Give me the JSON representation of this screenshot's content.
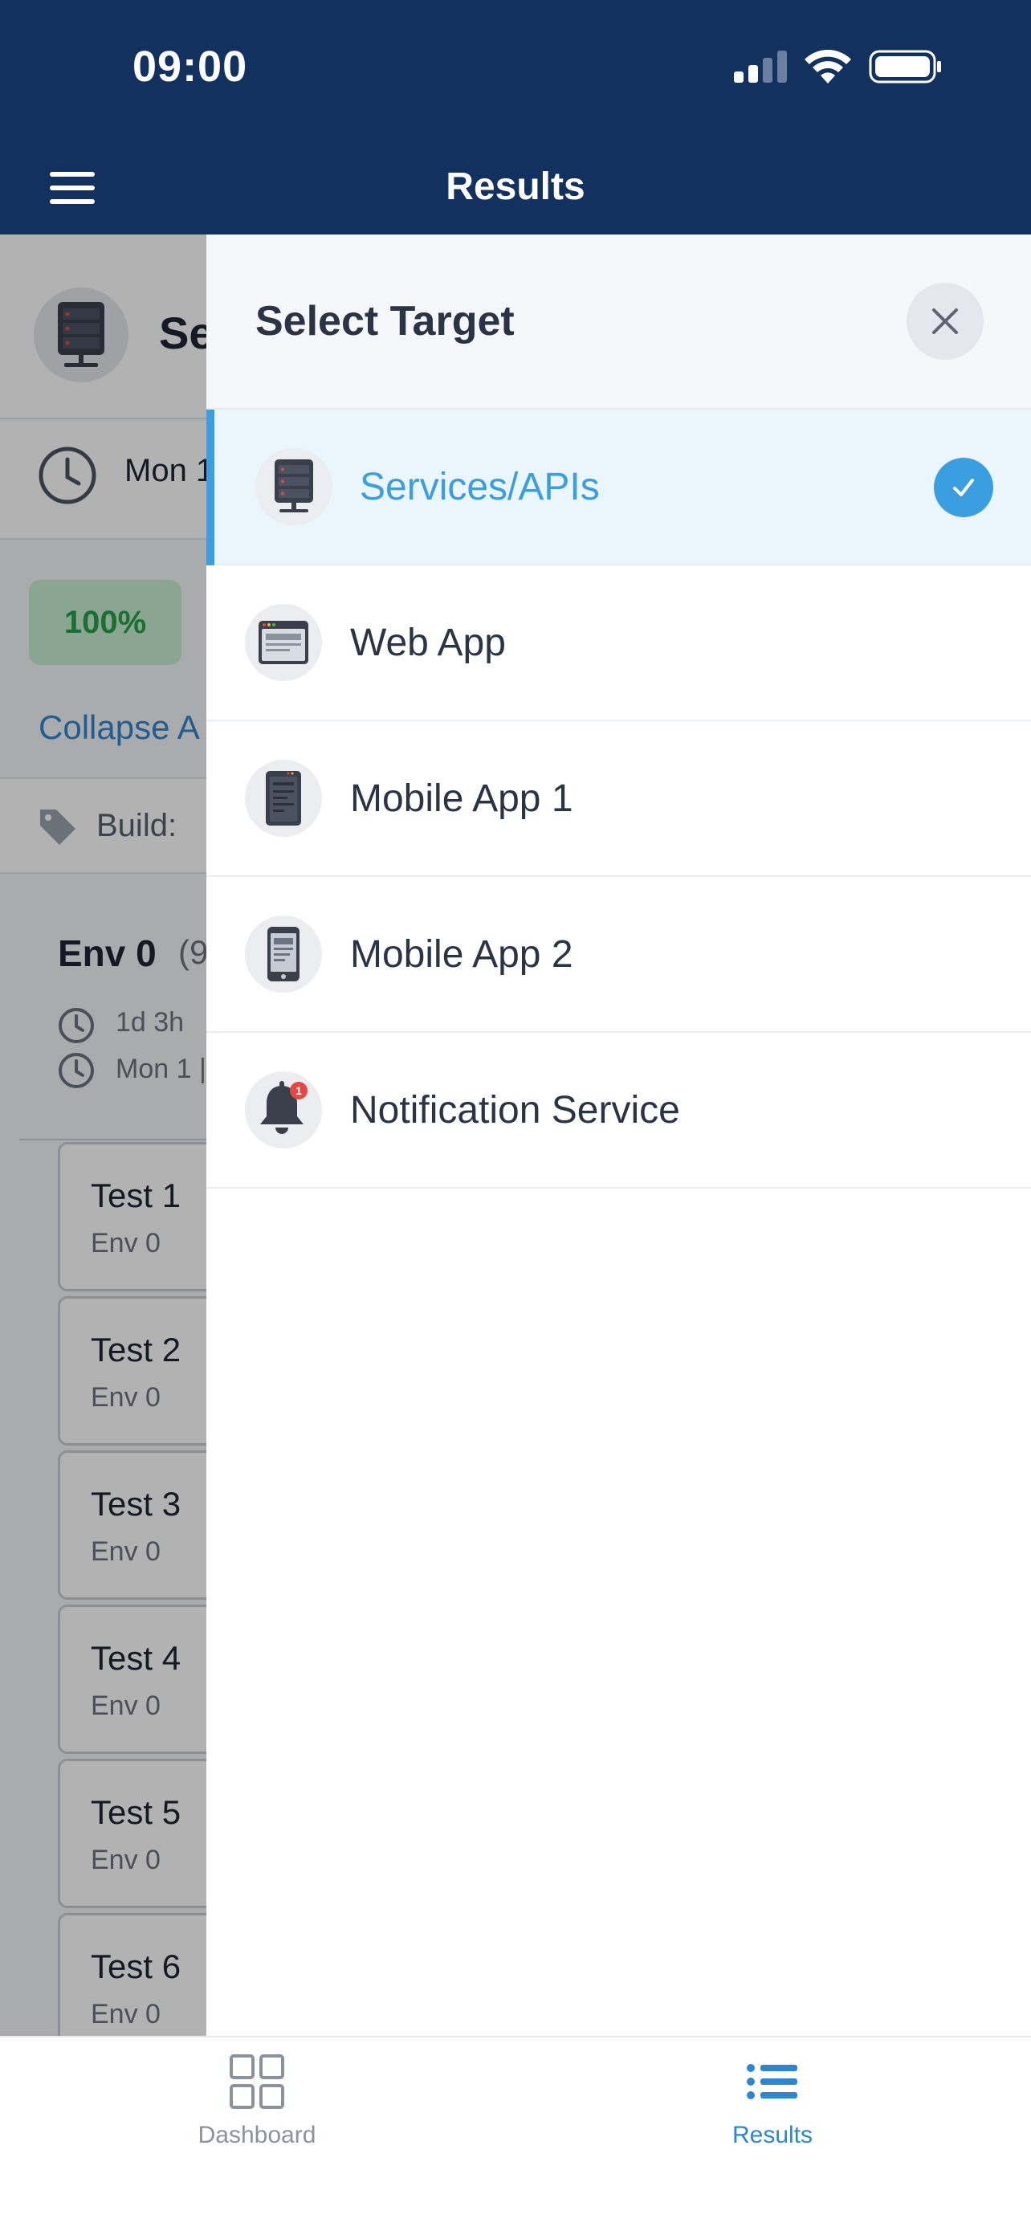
{
  "status_bar": {
    "time": "09:00"
  },
  "header": {
    "title": "Results",
    "menu_icon": "hamburger-menu-icon"
  },
  "background_page": {
    "title": "Se",
    "date": "Mon 1",
    "success_badge": "100%",
    "collapse_label": "Collapse A",
    "build_label": "Build:",
    "env": {
      "name": "Env 0",
      "count": "(9",
      "duration": "1d 3h",
      "started": "Mon 1 |"
    },
    "tests": [
      {
        "name": "Test 1",
        "env": "Env 0"
      },
      {
        "name": "Test 2",
        "env": "Env 0"
      },
      {
        "name": "Test 3",
        "env": "Env 0"
      },
      {
        "name": "Test 4",
        "env": "Env 0"
      },
      {
        "name": "Test 5",
        "env": "Env 0"
      },
      {
        "name": "Test 6",
        "env": "Env 0"
      }
    ]
  },
  "drawer": {
    "title": "Select Target",
    "close_icon": "close-icon",
    "options": [
      {
        "label": "Services/APIs",
        "icon": "server-icon",
        "selected": true
      },
      {
        "label": "Web App",
        "icon": "browser-window-icon",
        "selected": false
      },
      {
        "label": "Mobile App 1",
        "icon": "mobile-app-icon",
        "selected": false
      },
      {
        "label": "Mobile App 2",
        "icon": "phone-icon",
        "selected": false
      },
      {
        "label": "Notification Service",
        "icon": "bell-icon",
        "selected": false,
        "badge": "1"
      }
    ]
  },
  "tabbar": {
    "tabs": [
      {
        "label": "Dashboard",
        "icon": "dashboard-grid-icon",
        "active": false
      },
      {
        "label": "Results",
        "icon": "list-icon",
        "active": true
      }
    ]
  },
  "colors": {
    "header": "#13315f",
    "accent": "#3a9ee0",
    "success": "#26a047"
  }
}
